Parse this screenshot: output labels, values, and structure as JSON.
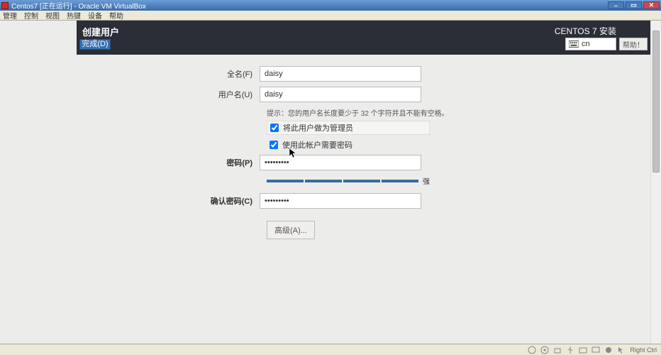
{
  "window": {
    "title": "Centos7 [正在运行] - Oracle VM VirtualBox",
    "buttons": {
      "min": "–",
      "max": "▭",
      "close": "✕"
    }
  },
  "menu": [
    "管理",
    "控制",
    "视图",
    "热键",
    "设备",
    "帮助"
  ],
  "installer": {
    "header_title": "创建用户",
    "done": "完成(D)",
    "product": "CENTOS 7 安装",
    "kbd": "cn",
    "help": "帮助！"
  },
  "form": {
    "fullname_label": "全名(F)",
    "fullname_value": "daisy",
    "username_label": "用户名(U)",
    "username_value": "daisy",
    "hint": "提示：您的用户名长度要少于 32 个字符并且不能有空格。",
    "make_admin": "将此用户做为管理员",
    "require_pw": "使用此帐户需要密码",
    "password_label": "密码(P)",
    "password_value": "•••••••••",
    "confirm_label": "确认密码(C)",
    "confirm_value": "•••••••••",
    "strength": "强",
    "advanced": "高级(A)..."
  },
  "statusbar": {
    "host_key": "Right Ctrl"
  }
}
